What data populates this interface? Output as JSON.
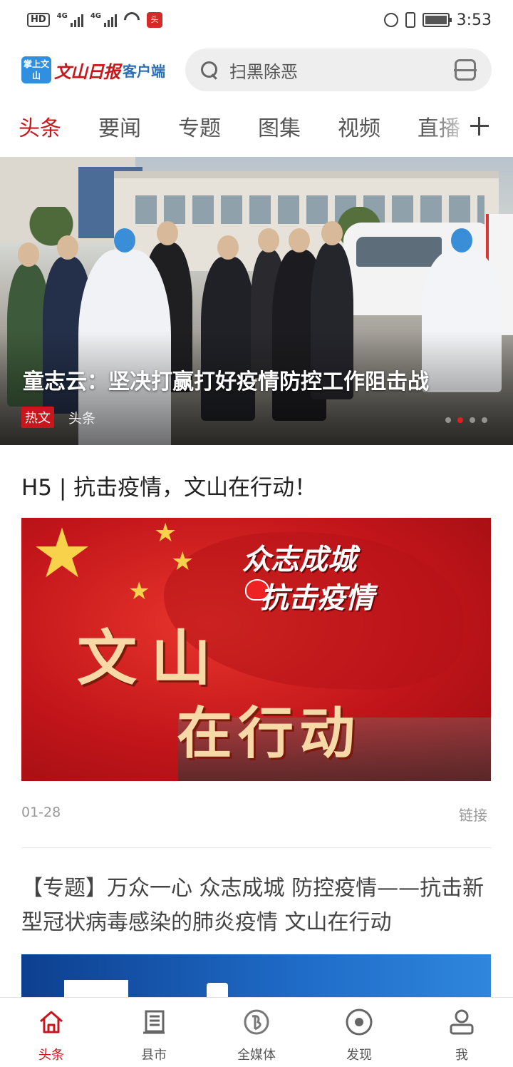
{
  "status_bar": {
    "hd": "HD",
    "net1": "4G",
    "net2": "4G",
    "time": "3:53",
    "app_badge": "头"
  },
  "header": {
    "logo_badge": "掌上文山",
    "logo_main": "文山日报",
    "logo_sub": "客户端",
    "search_placeholder": "扫黑除恶"
  },
  "tabs": [
    {
      "label": "头条",
      "active": true
    },
    {
      "label": "要闻",
      "active": false
    },
    {
      "label": "专题",
      "active": false
    },
    {
      "label": "图集",
      "active": false
    },
    {
      "label": "视频",
      "active": false
    },
    {
      "label": "直播",
      "active": false
    }
  ],
  "hero": {
    "title": "童志云：坚决打赢打好疫情防控工作阻击战",
    "tag": "热文",
    "category": "头条",
    "slide_count": 4,
    "active_slide": 2
  },
  "articles": [
    {
      "title": "H5 | 抗击疫情，文山在行动！",
      "image_text": {
        "slogan_line1": "众志成城",
        "slogan_line2": "抗击疫情",
        "big_line1": "文山",
        "big_line2": "在行动"
      },
      "date": "01-28",
      "type_label": "链接"
    },
    {
      "title": "【专题】万众一心 众志成城 防控疫情——抗击新型冠状病毒感染的肺炎疫情 文山在行动"
    }
  ],
  "bottom_nav": [
    {
      "label": "头条",
      "icon": "home-icon",
      "active": true
    },
    {
      "label": "县市",
      "icon": "county-icon",
      "active": false
    },
    {
      "label": "全媒体",
      "icon": "media-icon",
      "active": false
    },
    {
      "label": "发现",
      "icon": "discover-icon",
      "active": false
    },
    {
      "label": "我",
      "icon": "profile-icon",
      "active": false
    }
  ],
  "colors": {
    "accent": "#c8161d",
    "nav_inactive": "#555555",
    "meta_gray": "#999999"
  }
}
